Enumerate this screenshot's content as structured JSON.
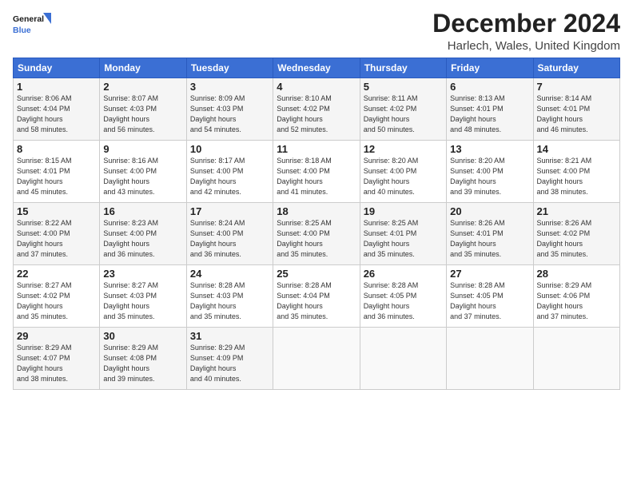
{
  "header": {
    "logo_line1": "General",
    "logo_line2": "Blue",
    "title": "December 2024",
    "subtitle": "Harlech, Wales, United Kingdom"
  },
  "days_of_week": [
    "Sunday",
    "Monday",
    "Tuesday",
    "Wednesday",
    "Thursday",
    "Friday",
    "Saturday"
  ],
  "weeks": [
    [
      {
        "num": "1",
        "rise": "8:06 AM",
        "set": "4:04 PM",
        "daylight": "7 hours and 58 minutes."
      },
      {
        "num": "2",
        "rise": "8:07 AM",
        "set": "4:03 PM",
        "daylight": "7 hours and 56 minutes."
      },
      {
        "num": "3",
        "rise": "8:09 AM",
        "set": "4:03 PM",
        "daylight": "7 hours and 54 minutes."
      },
      {
        "num": "4",
        "rise": "8:10 AM",
        "set": "4:02 PM",
        "daylight": "7 hours and 52 minutes."
      },
      {
        "num": "5",
        "rise": "8:11 AM",
        "set": "4:02 PM",
        "daylight": "7 hours and 50 minutes."
      },
      {
        "num": "6",
        "rise": "8:13 AM",
        "set": "4:01 PM",
        "daylight": "7 hours and 48 minutes."
      },
      {
        "num": "7",
        "rise": "8:14 AM",
        "set": "4:01 PM",
        "daylight": "7 hours and 46 minutes."
      }
    ],
    [
      {
        "num": "8",
        "rise": "8:15 AM",
        "set": "4:01 PM",
        "daylight": "7 hours and 45 minutes."
      },
      {
        "num": "9",
        "rise": "8:16 AM",
        "set": "4:00 PM",
        "daylight": "7 hours and 43 minutes."
      },
      {
        "num": "10",
        "rise": "8:17 AM",
        "set": "4:00 PM",
        "daylight": "7 hours and 42 minutes."
      },
      {
        "num": "11",
        "rise": "8:18 AM",
        "set": "4:00 PM",
        "daylight": "7 hours and 41 minutes."
      },
      {
        "num": "12",
        "rise": "8:20 AM",
        "set": "4:00 PM",
        "daylight": "7 hours and 40 minutes."
      },
      {
        "num": "13",
        "rise": "8:20 AM",
        "set": "4:00 PM",
        "daylight": "7 hours and 39 minutes."
      },
      {
        "num": "14",
        "rise": "8:21 AM",
        "set": "4:00 PM",
        "daylight": "7 hours and 38 minutes."
      }
    ],
    [
      {
        "num": "15",
        "rise": "8:22 AM",
        "set": "4:00 PM",
        "daylight": "7 hours and 37 minutes."
      },
      {
        "num": "16",
        "rise": "8:23 AM",
        "set": "4:00 PM",
        "daylight": "7 hours and 36 minutes."
      },
      {
        "num": "17",
        "rise": "8:24 AM",
        "set": "4:00 PM",
        "daylight": "7 hours and 36 minutes."
      },
      {
        "num": "18",
        "rise": "8:25 AM",
        "set": "4:00 PM",
        "daylight": "7 hours and 35 minutes."
      },
      {
        "num": "19",
        "rise": "8:25 AM",
        "set": "4:01 PM",
        "daylight": "7 hours and 35 minutes."
      },
      {
        "num": "20",
        "rise": "8:26 AM",
        "set": "4:01 PM",
        "daylight": "7 hours and 35 minutes."
      },
      {
        "num": "21",
        "rise": "8:26 AM",
        "set": "4:02 PM",
        "daylight": "7 hours and 35 minutes."
      }
    ],
    [
      {
        "num": "22",
        "rise": "8:27 AM",
        "set": "4:02 PM",
        "daylight": "7 hours and 35 minutes."
      },
      {
        "num": "23",
        "rise": "8:27 AM",
        "set": "4:03 PM",
        "daylight": "7 hours and 35 minutes."
      },
      {
        "num": "24",
        "rise": "8:28 AM",
        "set": "4:03 PM",
        "daylight": "7 hours and 35 minutes."
      },
      {
        "num": "25",
        "rise": "8:28 AM",
        "set": "4:04 PM",
        "daylight": "7 hours and 35 minutes."
      },
      {
        "num": "26",
        "rise": "8:28 AM",
        "set": "4:05 PM",
        "daylight": "7 hours and 36 minutes."
      },
      {
        "num": "27",
        "rise": "8:28 AM",
        "set": "4:05 PM",
        "daylight": "7 hours and 37 minutes."
      },
      {
        "num": "28",
        "rise": "8:29 AM",
        "set": "4:06 PM",
        "daylight": "7 hours and 37 minutes."
      }
    ],
    [
      {
        "num": "29",
        "rise": "8:29 AM",
        "set": "4:07 PM",
        "daylight": "7 hours and 38 minutes."
      },
      {
        "num": "30",
        "rise": "8:29 AM",
        "set": "4:08 PM",
        "daylight": "7 hours and 39 minutes."
      },
      {
        "num": "31",
        "rise": "8:29 AM",
        "set": "4:09 PM",
        "daylight": "7 hours and 40 minutes."
      },
      null,
      null,
      null,
      null
    ]
  ]
}
